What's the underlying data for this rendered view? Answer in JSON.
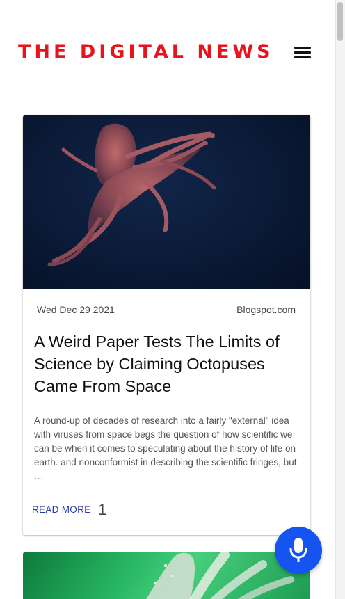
{
  "header": {
    "brand": "THE DIGITAL NEWS",
    "brand_color": "#e8141c",
    "menu_icon": "hamburger-menu-icon"
  },
  "articles": [
    {
      "image": "octopus-photo",
      "date": "Wed Dec 29 2021",
      "source": "Blogspot.com",
      "title": "A Weird Paper Tests The Limits of Science by Claiming Octopuses Came From Space",
      "excerpt": "A round-up of decades of research into a fairly \"external\" idea with viruses from space begs the question of how scientific we can be when it comes to speculating about the history of life on earth. and nonconformist in describing the scientific fringes, but …",
      "read_more": "READ MORE",
      "count": "1"
    },
    {
      "image": "green-hand-photo"
    }
  ],
  "fab": {
    "icon": "microphone-icon",
    "color": "#1554f0"
  }
}
